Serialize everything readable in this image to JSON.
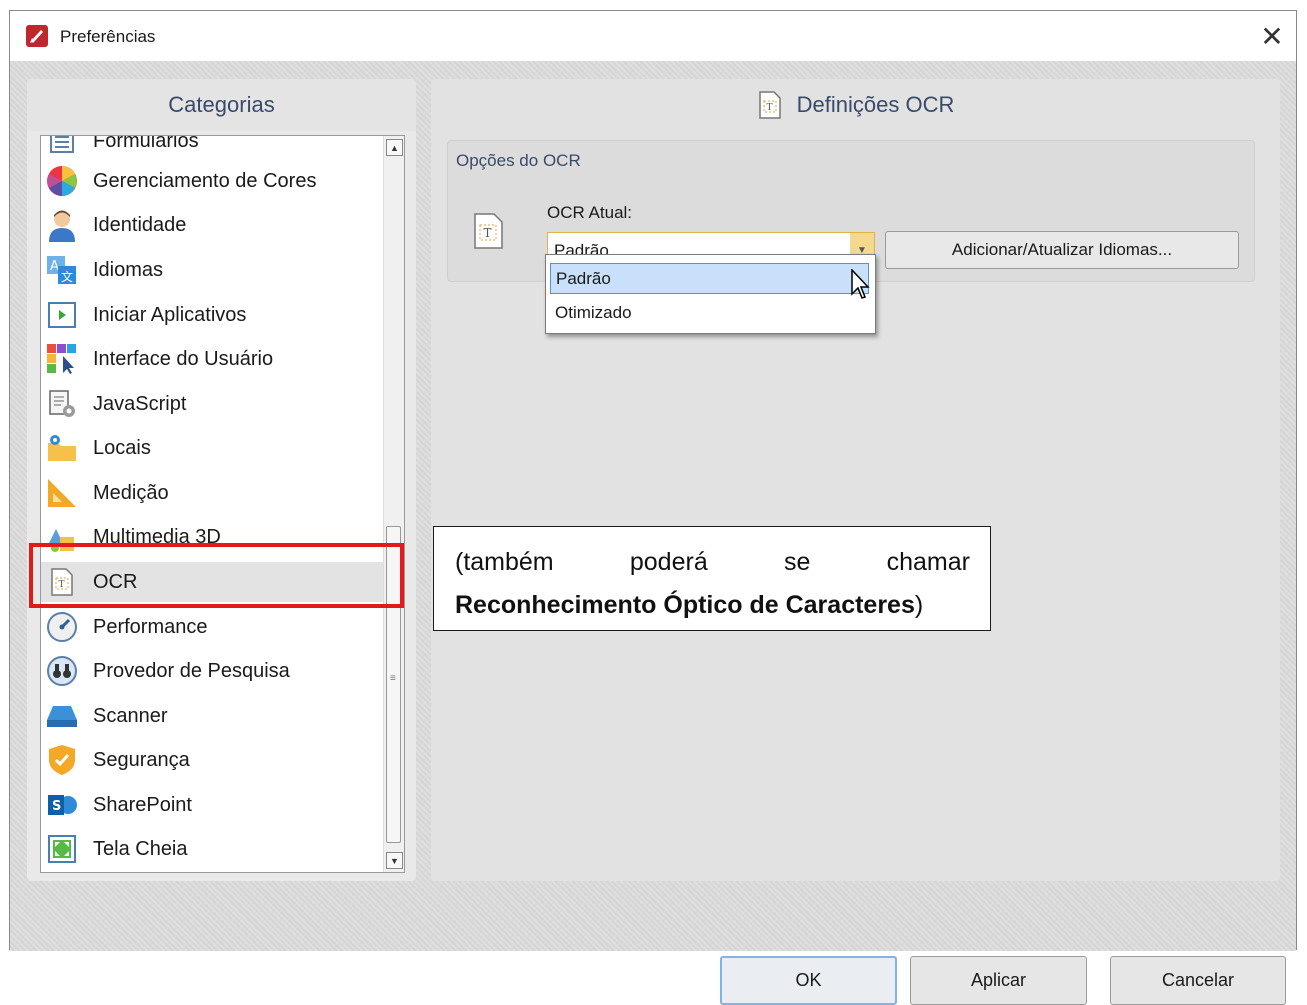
{
  "window": {
    "title": "Preferências",
    "close_label": "✕"
  },
  "left_panel": {
    "header": "Categorias",
    "partial_item": "Formulários",
    "items": [
      {
        "label": "Gerenciamento de Cores",
        "icon": "color-wheel-icon"
      },
      {
        "label": "Identidade",
        "icon": "user-icon"
      },
      {
        "label": "Idiomas",
        "icon": "language-icon"
      },
      {
        "label": "Iniciar Aplicativos",
        "icon": "launch-app-icon"
      },
      {
        "label": "Interface do Usuário",
        "icon": "ui-icon"
      },
      {
        "label": "JavaScript",
        "icon": "script-gear-icon"
      },
      {
        "label": "Locais",
        "icon": "folder-location-icon"
      },
      {
        "label": "Medição",
        "icon": "ruler-triangle-icon"
      },
      {
        "label": "Multimedia 3D",
        "icon": "3d-shapes-icon"
      },
      {
        "label": "OCR",
        "icon": "ocr-icon"
      },
      {
        "label": "Performance",
        "icon": "gauge-icon"
      },
      {
        "label": "Provedor de Pesquisa",
        "icon": "binoculars-icon"
      },
      {
        "label": "Scanner",
        "icon": "scanner-icon"
      },
      {
        "label": "Segurança",
        "icon": "shield-icon"
      },
      {
        "label": "SharePoint",
        "icon": "sharepoint-icon"
      },
      {
        "label": "Tela Cheia",
        "icon": "fullscreen-icon"
      }
    ],
    "selected": "OCR"
  },
  "right_panel": {
    "header": "Definições OCR",
    "group_title": "Opções do OCR",
    "ocr_label": "OCR Atual:",
    "combo_value": "Padrão",
    "add_button": "Adicionar/Atualizar Idiomas...",
    "dropdown_options": [
      "Padrão",
      "Otimizado"
    ],
    "dropdown_highlighted": "Padrão"
  },
  "note": {
    "line1_words": [
      "(também",
      "poderá",
      "se",
      "chamar"
    ],
    "line2_bold": "Reconhecimento Óptico de Caracteres",
    "line2_tail": ")"
  },
  "buttons": {
    "ok": "OK",
    "apply": "Aplicar",
    "cancel": "Cancelar"
  },
  "colors": {
    "highlight_border": "#e11b1b",
    "selection": "#c8e0fa",
    "header_text": "#3a4a6a"
  }
}
